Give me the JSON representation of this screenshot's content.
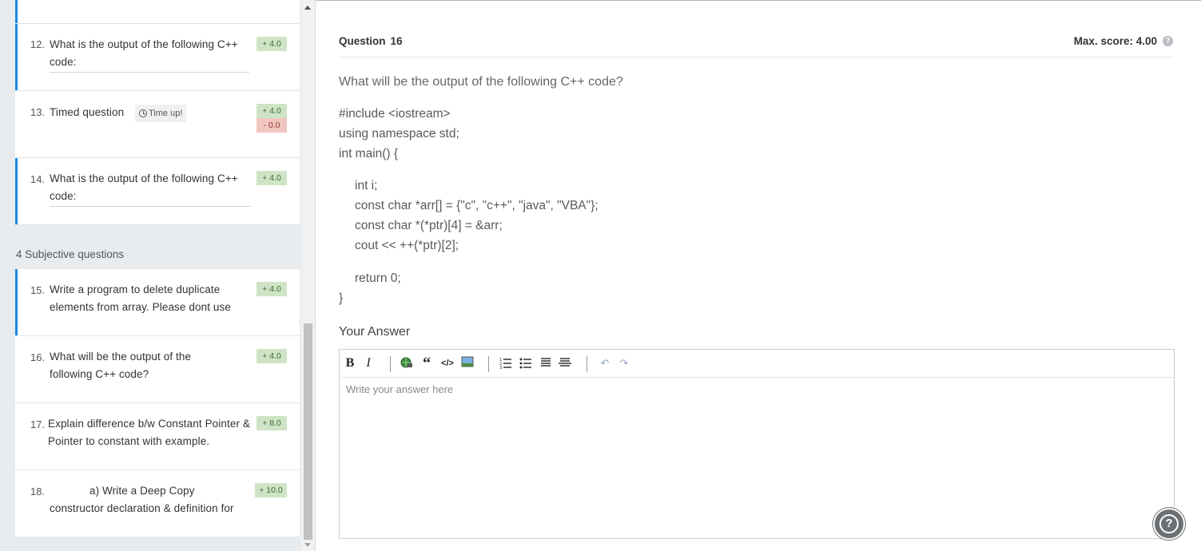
{
  "sidebar": {
    "section_label": "4 Subjective questions",
    "questions": [
      {
        "num": "12.",
        "title": "What is the output of the following C++ code:",
        "score": "+ 4.0"
      },
      {
        "num": "13.",
        "title": "Timed question",
        "badge": "Time up!",
        "score": "+ 4.0",
        "penalty": "- 0.0"
      },
      {
        "num": "14.",
        "title": "What is the output of the following C++ code:",
        "score": "+ 4.0"
      },
      {
        "num": "15.",
        "title": "Write a program to delete duplicate elements from array. Please dont use",
        "score": "+ 4.0"
      },
      {
        "num": "16.",
        "title": "What will be the output of the following C++ code?",
        "score": "+ 4.0"
      },
      {
        "num": "17.",
        "title": "Explain difference b/w Constant Pointer & Pointer to constant with example.",
        "score": "+ 8.0"
      },
      {
        "num": "18.",
        "title": "a) Write a Deep Copy constructor declaration & definition for",
        "score": "+ 10.0"
      }
    ]
  },
  "main": {
    "question_label": "Question",
    "question_number": "16",
    "max_score": "Max. score: 4.00",
    "question_text": "What will be the output of the following C++ code?",
    "code_lines": [
      "#include <iostream>",
      "using namespace std;",
      "int main() {",
      "int i;",
      "const char *arr[] = {\"c\", \"c++\", \"java\", \"VBA\"};",
      "const char *(*ptr)[4] = &arr;",
      "cout << ++(*ptr)[2];",
      "return 0;",
      "}"
    ],
    "answer_heading": "Your Answer",
    "answer_placeholder": "Write your answer here",
    "toolbar": {
      "bold": "B",
      "italic": "I",
      "quote": "“",
      "code": "</>",
      "undo": "↶",
      "redo": "↷"
    }
  },
  "help": "?"
}
